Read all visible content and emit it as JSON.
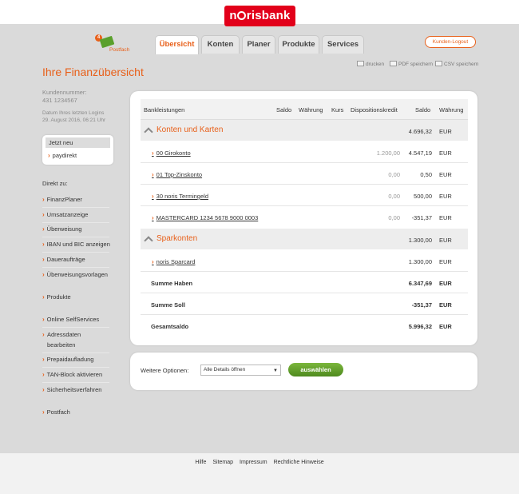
{
  "brand": {
    "logo_text_pre": "n",
    "logo_text_post": "risbank",
    "logo_color": "#e2001a",
    "accent": "#e8601a"
  },
  "postfach": {
    "count": "4",
    "label": "Postfach"
  },
  "tabs": [
    {
      "label": "Übersicht",
      "active": true
    },
    {
      "label": "Konten",
      "active": false
    },
    {
      "label": "Planer",
      "active": false
    },
    {
      "label": "Produkte",
      "active": false
    },
    {
      "label": "Services",
      "active": false
    }
  ],
  "logout_label": "Kunden-Logout",
  "tools": {
    "print": "drucken",
    "pdf": "PDF speichern",
    "csv": "CSV speichern"
  },
  "left": {
    "page_title": "Ihre Finanzübersicht",
    "kunde_label": "Kundennummer:",
    "kunde_nr": "431 1234567",
    "login_label": "Datum Ihres letzten Logins",
    "login_date": "29. August 2016, 06:21 Uhr",
    "jetzt_neu": "Jetzt neu",
    "jetzt_item": "paydirekt",
    "direkt_label": "Direkt zu:",
    "nav": {
      "finanzplaner": "FinanzPlaner",
      "umsatzanzeige": "Umsatzanzeige",
      "ueberweisung": "Überweisung",
      "iban": "IBAN und BIC anzeigen",
      "dauerauftraege": "Daueraufträge",
      "vorlagen": "Überweisungsvorlagen",
      "produkte": "Produkte",
      "selfservices": "Online SelfServices",
      "adressdaten": "Adressdaten bearbeiten",
      "prepaid": "Prepaidaufladung",
      "tanblock": "TAN-Block aktivieren",
      "sicherheit": "Sicherheitsverfahren",
      "postfach": "Postfach"
    }
  },
  "table": {
    "headers": {
      "bankleistungen": "Bankleistungen",
      "saldo1": "Saldo",
      "waehrung1": "Währung",
      "kurs": "Kurs",
      "dispo": "Dispositionskredit",
      "saldo2": "Saldo",
      "waehrung2": "Währung"
    },
    "sections": [
      {
        "title": "Konten und Karten",
        "saldo": "4.696,32",
        "cur": "EUR"
      },
      {
        "title": "Sparkonten",
        "saldo": "1.300,00",
        "cur": "EUR"
      }
    ],
    "rows": [
      {
        "name": "00 Girokonto",
        "dispo": "1.200,00",
        "saldo": "4.547,19",
        "cur": "EUR"
      },
      {
        "name": "01 Top-Zinskonto",
        "dispo": "0,00",
        "saldo": "0,50",
        "cur": "EUR"
      },
      {
        "name": "30 noris Termingeld",
        "dispo": "0,00",
        "saldo": "500,00",
        "cur": "EUR"
      },
      {
        "name": "MASTERCARD 1234 5678 9000 0003",
        "dispo": "0,00",
        "saldo": "-351,37",
        "cur": "EUR"
      },
      {
        "name": "noris Sparcard",
        "dispo": "",
        "saldo": "1.300,00",
        "cur": "EUR"
      }
    ],
    "sums": [
      {
        "name": "Summe Haben",
        "saldo": "6.347,69",
        "cur": "EUR"
      },
      {
        "name": "Summe Soll",
        "saldo": "-351,37",
        "cur": "EUR"
      },
      {
        "name": "Gesamtsaldo",
        "saldo": "5.996,32",
        "cur": "EUR"
      }
    ]
  },
  "options": {
    "label": "Weitere Optionen:",
    "select_value": "Alle Details öffnen",
    "button": "auswählen"
  },
  "footer": {
    "hilfe": "Hilfe",
    "sitemap": "Sitemap",
    "impressum": "Impressum",
    "rechtliches": "Rechtliche Hinweise"
  }
}
